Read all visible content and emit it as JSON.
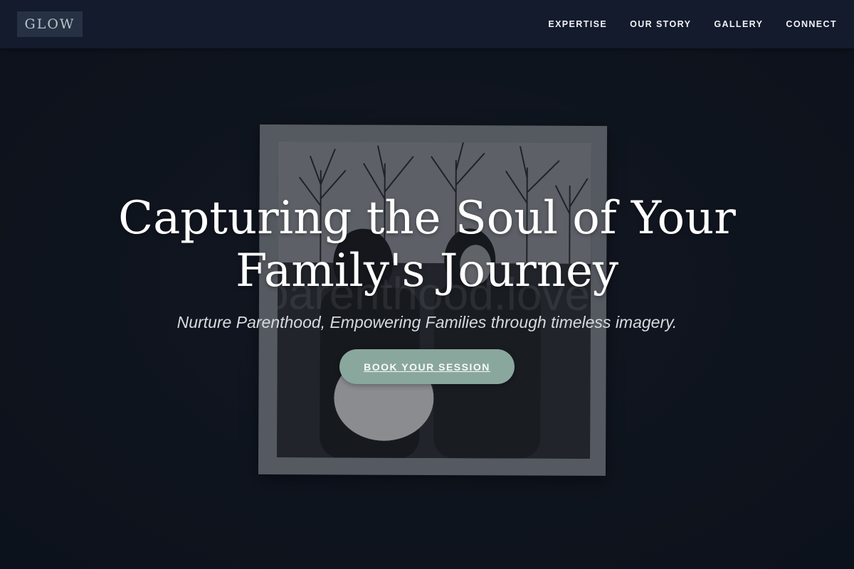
{
  "brand": {
    "logo_text": "GLOW"
  },
  "nav": {
    "items": [
      {
        "label": "EXPERTISE"
      },
      {
        "label": "OUR STORY"
      },
      {
        "label": "GALLERY"
      },
      {
        "label": "CONNECT"
      }
    ]
  },
  "hero": {
    "title_line1": "Capturing the Soul of Your",
    "title_line2": "Family's Journey",
    "subtitle": "Nurture Parenthood, Empowering Families through timeless imagery.",
    "cta_label": "BOOK YOUR SESSION",
    "background_image": {
      "watermark_text": "parenthood.love"
    }
  },
  "colors": {
    "navbar_bg": "#141b2c",
    "page_bg": "#121722",
    "logo_bg": "#263243",
    "cta_bg": "#8aa79d",
    "text_primary": "#ffffff"
  }
}
